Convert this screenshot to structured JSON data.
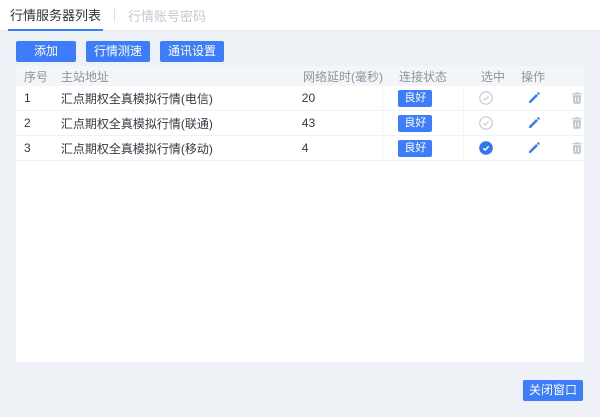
{
  "tabs": [
    {
      "label": "行情服务器列表",
      "active": true
    },
    {
      "label": "行情账号密码",
      "active": false
    }
  ],
  "toolbar": {
    "add_label": "添加",
    "speed_test_label": "行情测速",
    "comm_settings_label": "通讯设置"
  },
  "table": {
    "headers": {
      "index": "序号",
      "address": "主站地址",
      "delay": "网络延时(毫秒)",
      "status": "连接状态",
      "selected": "选中",
      "action": "操作"
    },
    "rows": [
      {
        "index": "1",
        "address": "汇点期权全真模拟行情(电信)",
        "delay": "20",
        "status": "良好",
        "selected": false
      },
      {
        "index": "2",
        "address": "汇点期权全真模拟行情(联通)",
        "delay": "43",
        "status": "良好",
        "selected": false
      },
      {
        "index": "3",
        "address": "汇点期权全真模拟行情(移动)",
        "delay": "4",
        "status": "良好",
        "selected": true
      }
    ]
  },
  "footer": {
    "close_label": "关闭窗口"
  },
  "colors": {
    "primary_blue": "#3D7DFB",
    "status_badge_bg": "#3D7DFB",
    "panel_bg": "#EEF1F5",
    "table_header_bg": "#F3F5F8",
    "inactive_tab_text": "#C2C8D2",
    "muted_icon_gray": "#C1C6CE"
  },
  "icons": {
    "edit": "edit-pencil-icon",
    "delete": "trash-icon",
    "selected_on": "check-circle-filled-icon",
    "selected_off": "check-circle-outline-icon"
  }
}
